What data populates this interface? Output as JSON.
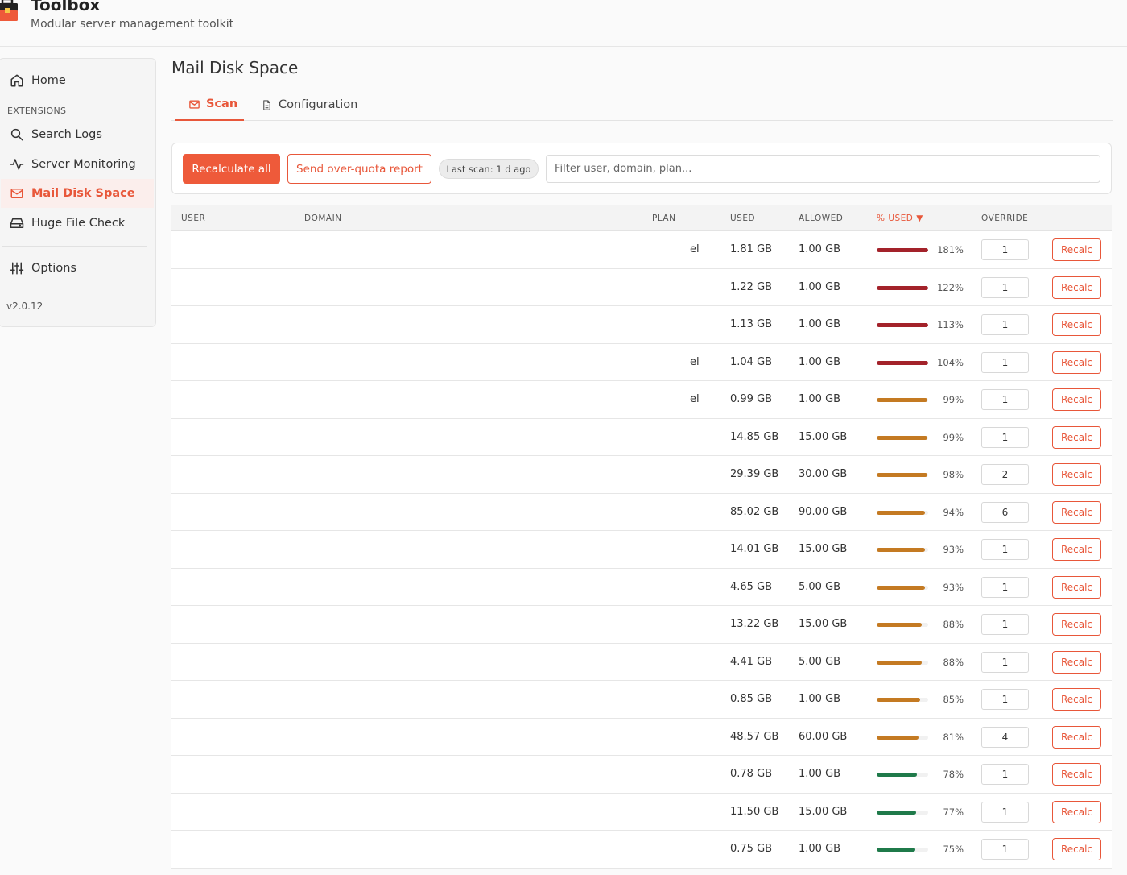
{
  "app": {
    "title": "Toolbox",
    "subtitle": "Modular server management toolkit"
  },
  "sidebar": {
    "home": "Home",
    "section_label": "EXTENSIONS",
    "items": [
      {
        "label": "Search Logs",
        "icon": "search-icon"
      },
      {
        "label": "Server Monitoring",
        "icon": "activity-icon"
      },
      {
        "label": "Mail Disk Space",
        "icon": "mail-icon",
        "active": true
      },
      {
        "label": "Huge File Check",
        "icon": "hard-drive-icon"
      }
    ],
    "options": "Options",
    "version": "v2.0.12"
  },
  "page": {
    "title": "Mail Disk Space"
  },
  "tabs": [
    {
      "label": "Scan",
      "icon": "mail-icon",
      "active": true
    },
    {
      "label": "Configuration",
      "icon": "file-icon"
    }
  ],
  "toolbar": {
    "recalculate_all": "Recalculate all",
    "send_report": "Send over-quota report",
    "last_scan": "Last scan: 1 d ago",
    "filter_placeholder": "Filter user, domain, plan..."
  },
  "table": {
    "headers": {
      "user": "USER",
      "domain": "DOMAIN",
      "plan": "PLAN",
      "used": "USED",
      "allowed": "ALLOWED",
      "pct_used": "% USED ▼",
      "override": "OVERRIDE"
    },
    "recalc_label": "Recalc",
    "colors": {
      "over": "#a3222a",
      "warn": "#c47a22",
      "ok": "#1f7a4a"
    },
    "rows": [
      {
        "plan_fragment": "el",
        "used": "1.81 GB",
        "allowed": "1.00 GB",
        "pct": 181,
        "pct_label": "181%",
        "override": "1"
      },
      {
        "plan_fragment": "",
        "used": "1.22 GB",
        "allowed": "1.00 GB",
        "pct": 122,
        "pct_label": "122%",
        "override": "1"
      },
      {
        "plan_fragment": "",
        "used": "1.13 GB",
        "allowed": "1.00 GB",
        "pct": 113,
        "pct_label": "113%",
        "override": "1"
      },
      {
        "plan_fragment": "el",
        "used": "1.04 GB",
        "allowed": "1.00 GB",
        "pct": 104,
        "pct_label": "104%",
        "override": "1"
      },
      {
        "plan_fragment": "el",
        "used": "0.99 GB",
        "allowed": "1.00 GB",
        "pct": 99,
        "pct_label": "99%",
        "override": "1"
      },
      {
        "plan_fragment": "",
        "used": "14.85 GB",
        "allowed": "15.00 GB",
        "pct": 99,
        "pct_label": "99%",
        "override": "1"
      },
      {
        "plan_fragment": "",
        "used": "29.39 GB",
        "allowed": "30.00 GB",
        "pct": 98,
        "pct_label": "98%",
        "override": "2"
      },
      {
        "plan_fragment": "",
        "used": "85.02 GB",
        "allowed": "90.00 GB",
        "pct": 94,
        "pct_label": "94%",
        "override": "6"
      },
      {
        "plan_fragment": "",
        "used": "14.01 GB",
        "allowed": "15.00 GB",
        "pct": 93,
        "pct_label": "93%",
        "override": "1"
      },
      {
        "plan_fragment": "",
        "used": "4.65 GB",
        "allowed": "5.00 GB",
        "pct": 93,
        "pct_label": "93%",
        "override": "1"
      },
      {
        "plan_fragment": "",
        "used": "13.22 GB",
        "allowed": "15.00 GB",
        "pct": 88,
        "pct_label": "88%",
        "override": "1"
      },
      {
        "plan_fragment": "",
        "used": "4.41 GB",
        "allowed": "5.00 GB",
        "pct": 88,
        "pct_label": "88%",
        "override": "1"
      },
      {
        "plan_fragment": "",
        "used": "0.85 GB",
        "allowed": "1.00 GB",
        "pct": 85,
        "pct_label": "85%",
        "override": "1"
      },
      {
        "plan_fragment": "",
        "used": "48.57 GB",
        "allowed": "60.00 GB",
        "pct": 81,
        "pct_label": "81%",
        "override": "4"
      },
      {
        "plan_fragment": "",
        "used": "0.78 GB",
        "allowed": "1.00 GB",
        "pct": 78,
        "pct_label": "78%",
        "override": "1"
      },
      {
        "plan_fragment": "",
        "used": "11.50 GB",
        "allowed": "15.00 GB",
        "pct": 77,
        "pct_label": "77%",
        "override": "1"
      },
      {
        "plan_fragment": "",
        "used": "0.75 GB",
        "allowed": "1.00 GB",
        "pct": 75,
        "pct_label": "75%",
        "override": "1"
      }
    ]
  }
}
